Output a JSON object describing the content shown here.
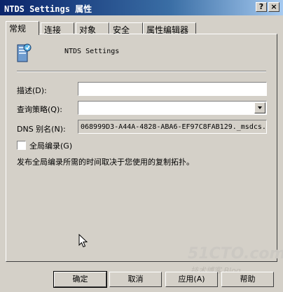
{
  "window": {
    "title": "NTDS Settings 属性",
    "help_btn": "?",
    "close_btn": "×"
  },
  "tabs": [
    {
      "label": "常规",
      "active": true
    },
    {
      "label": "连接"
    },
    {
      "label": "对象"
    },
    {
      "label": "安全"
    },
    {
      "label": "属性编辑器"
    }
  ],
  "general": {
    "object_name": "NTDS Settings",
    "description_label": "描述(D):",
    "description_value": "",
    "query_policy_label": "查询策略(Q):",
    "query_policy_value": "",
    "dns_alias_label": "DNS 别名(N):",
    "dns_alias_value": "068999D3-A44A-4828-ABA6-EF97C8FAB129._msdcs.",
    "global_catalog_label": "全局编录(G)",
    "global_catalog_checked": false,
    "note": "发布全局编录所需的时间取决于您使用的复制拓扑。"
  },
  "buttons": {
    "ok": "确定",
    "cancel": "取消",
    "apply": "应用(A)",
    "help": "帮助"
  },
  "watermark": {
    "line1": "51CTO.com",
    "line2": "技术博客 Blog"
  }
}
